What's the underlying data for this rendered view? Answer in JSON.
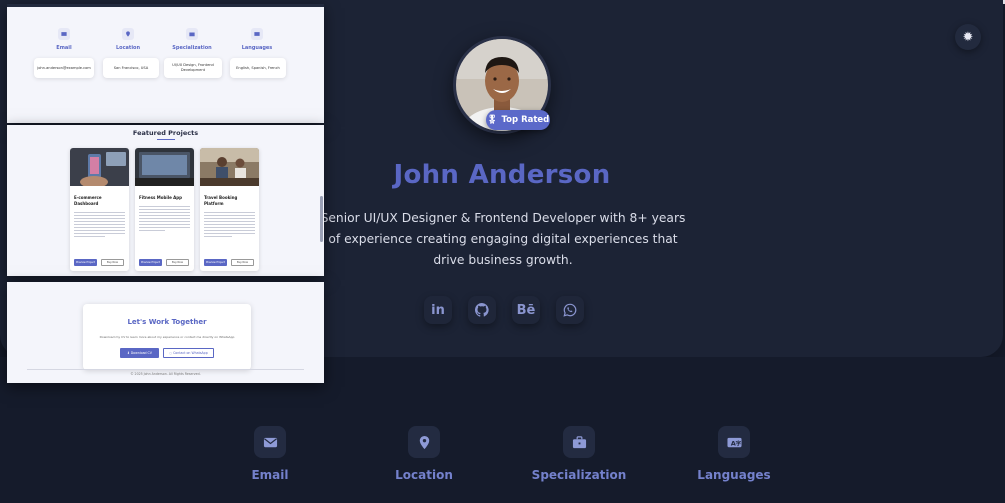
{
  "profile": {
    "name": "John Anderson",
    "badge": "Top Rated",
    "tagline": "Senior UI/UX Designer & Frontend Developer with 8+ years of experience creating engaging digital experiences that drive business growth."
  },
  "theme_toggle_icon": "sun-icon",
  "socials": [
    {
      "icon": "linkedin-icon",
      "glyph": "in"
    },
    {
      "icon": "github-icon",
      "glyph": ""
    },
    {
      "icon": "behance-icon",
      "glyph": "Bē"
    },
    {
      "icon": "whatsapp-icon",
      "glyph": ""
    }
  ],
  "info": [
    {
      "label": "Email",
      "icon": "envelope-icon"
    },
    {
      "label": "Location",
      "icon": "map-pin-icon"
    },
    {
      "label": "Specialization",
      "icon": "briefcase-icon"
    },
    {
      "label": "Languages",
      "icon": "translate-icon"
    }
  ],
  "preview_info": {
    "labels": [
      "Email",
      "Location",
      "Specialization",
      "Languages"
    ],
    "values": [
      "john.anderson@example.com",
      "San Francisco, USA",
      "UI/UX Design, Frontend Development",
      "English, Spanish, French"
    ]
  },
  "projects": {
    "title": "Featured Projects",
    "items": [
      {
        "title": "E-commerce Dashboard",
        "primary": "Preview Project",
        "secondary": "Buy Now"
      },
      {
        "title": "Fitness Mobile App",
        "primary": "Preview Project",
        "secondary": "Buy Now"
      },
      {
        "title": "Travel Booking Platform",
        "primary": "Preview Project",
        "secondary": "Buy Now"
      }
    ]
  },
  "contact": {
    "title": "Let's Work Together",
    "subtitle": "Download my CV to learn more about my experience or contact me directly on WhatsApp",
    "download": "Download CV",
    "whatsapp": "Contact on WhatsApp",
    "footer": "© 2025 John Anderson. All Rights Reserved."
  },
  "colors": {
    "accent": "#5a67c4",
    "background": "#161c2d",
    "hero": "#1c2335"
  }
}
